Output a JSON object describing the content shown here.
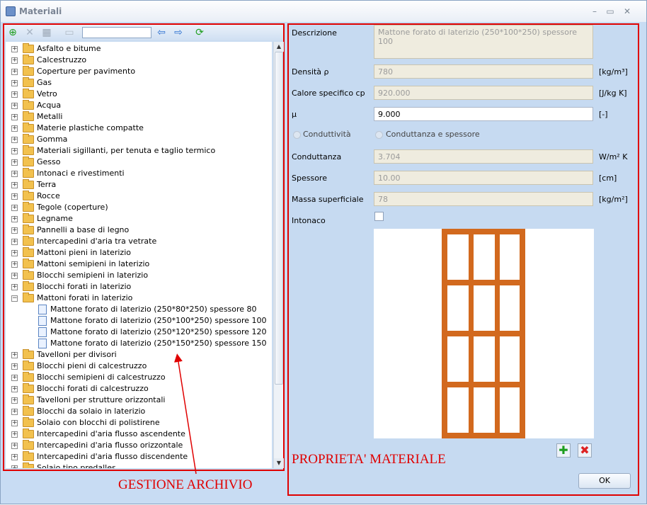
{
  "window": {
    "title": "Materiali"
  },
  "toolbar": {
    "search_value": ""
  },
  "tree": {
    "items": [
      {
        "label": "Asfalto e bitume",
        "type": "folder",
        "expanded": false
      },
      {
        "label": "Calcestruzzo",
        "type": "folder",
        "expanded": false
      },
      {
        "label": "Coperture per pavimento",
        "type": "folder",
        "expanded": false
      },
      {
        "label": "Gas",
        "type": "folder",
        "expanded": false
      },
      {
        "label": "Vetro",
        "type": "folder",
        "expanded": false
      },
      {
        "label": "Acqua",
        "type": "folder",
        "expanded": false
      },
      {
        "label": "Metalli",
        "type": "folder",
        "expanded": false
      },
      {
        "label": "Materie plastiche compatte",
        "type": "folder",
        "expanded": false
      },
      {
        "label": "Gomma",
        "type": "folder",
        "expanded": false
      },
      {
        "label": "Materiali sigillanti, per tenuta e taglio termico",
        "type": "folder",
        "expanded": false
      },
      {
        "label": "Gesso",
        "type": "folder",
        "expanded": false
      },
      {
        "label": "Intonaci e rivestimenti",
        "type": "folder",
        "expanded": false
      },
      {
        "label": "Terra",
        "type": "folder",
        "expanded": false
      },
      {
        "label": "Rocce",
        "type": "folder",
        "expanded": false
      },
      {
        "label": "Tegole (coperture)",
        "type": "folder",
        "expanded": false
      },
      {
        "label": "Legname",
        "type": "folder",
        "expanded": false
      },
      {
        "label": "Pannelli a base di legno",
        "type": "folder",
        "expanded": false
      },
      {
        "label": "Intercapedini d'aria tra vetrate",
        "type": "folder",
        "expanded": false
      },
      {
        "label": "Mattoni pieni in laterizio",
        "type": "folder",
        "expanded": false
      },
      {
        "label": "Mattoni semipieni in laterizio",
        "type": "folder",
        "expanded": false
      },
      {
        "label": "Blocchi semipieni in laterizio",
        "type": "folder",
        "expanded": false
      },
      {
        "label": "Blocchi forati in laterizio",
        "type": "folder",
        "expanded": false
      },
      {
        "label": "Mattoni forati in laterizio",
        "type": "folder",
        "expanded": true
      },
      {
        "label": "Mattone forato di laterizio (250*80*250) spessore 80",
        "type": "item"
      },
      {
        "label": "Mattone forato di laterizio (250*100*250) spessore 100",
        "type": "item"
      },
      {
        "label": "Mattone forato di laterizio (250*120*250) spessore 120",
        "type": "item"
      },
      {
        "label": "Mattone forato di laterizio (250*150*250) spessore 150",
        "type": "item"
      },
      {
        "label": "Tavelloni per divisori",
        "type": "folder",
        "expanded": false
      },
      {
        "label": "Blocchi pieni di calcestruzzo",
        "type": "folder",
        "expanded": false
      },
      {
        "label": "Blocchi semipieni di calcestruzzo",
        "type": "folder",
        "expanded": false
      },
      {
        "label": "Blocchi forati di calcestruzzo",
        "type": "folder",
        "expanded": false
      },
      {
        "label": "Tavelloni per strutture orizzontali",
        "type": "folder",
        "expanded": false
      },
      {
        "label": "Blocchi da solaio in laterizio",
        "type": "folder",
        "expanded": false
      },
      {
        "label": "Solaio con blocchi di polistirene",
        "type": "folder",
        "expanded": false
      },
      {
        "label": "Intercapedini d'aria flusso ascendente",
        "type": "folder",
        "expanded": false
      },
      {
        "label": "Intercapedini d'aria flusso orizzontale",
        "type": "folder",
        "expanded": false
      },
      {
        "label": "Intercapedini d'aria flusso discendente",
        "type": "folder",
        "expanded": false
      },
      {
        "label": "Solaio tipo predalles",
        "type": "folder",
        "expanded": false
      }
    ]
  },
  "annotations": {
    "left": "GESTIONE ARCHIVIO",
    "right": "PROPRIETA'   MATERIALE"
  },
  "props": {
    "descrizione_label": "Descrizione",
    "descrizione_value": "Mattone forato di laterizio (250*100*250) spessore 100",
    "densita_label": "Densità ρ",
    "densita_value": "780",
    "densita_unit": "[kg/m³]",
    "calore_label": "Calore specifico cp",
    "calore_value": "920.000",
    "calore_unit": "[J/kg K]",
    "mu_label": "μ",
    "mu_value": "9.000",
    "mu_unit": "[-]",
    "radio_conduttivita": "Conduttività",
    "radio_conduttanza": "Conduttanza e spessore",
    "conduttanza_label": "Conduttanza",
    "conduttanza_value": "3.704",
    "conduttanza_unit": "W/m² K",
    "spessore_label": "Spessore",
    "spessore_value": "10.00",
    "spessore_unit": "[cm]",
    "massa_label": "Massa superficiale",
    "massa_value": "78",
    "massa_unit": "[kg/m²]",
    "intonaco_label": "Intonaco",
    "intonaco_checked": false,
    "ok_label": "OK"
  },
  "colors": {
    "annotation": "#e00000",
    "brick": "#d2691e"
  }
}
